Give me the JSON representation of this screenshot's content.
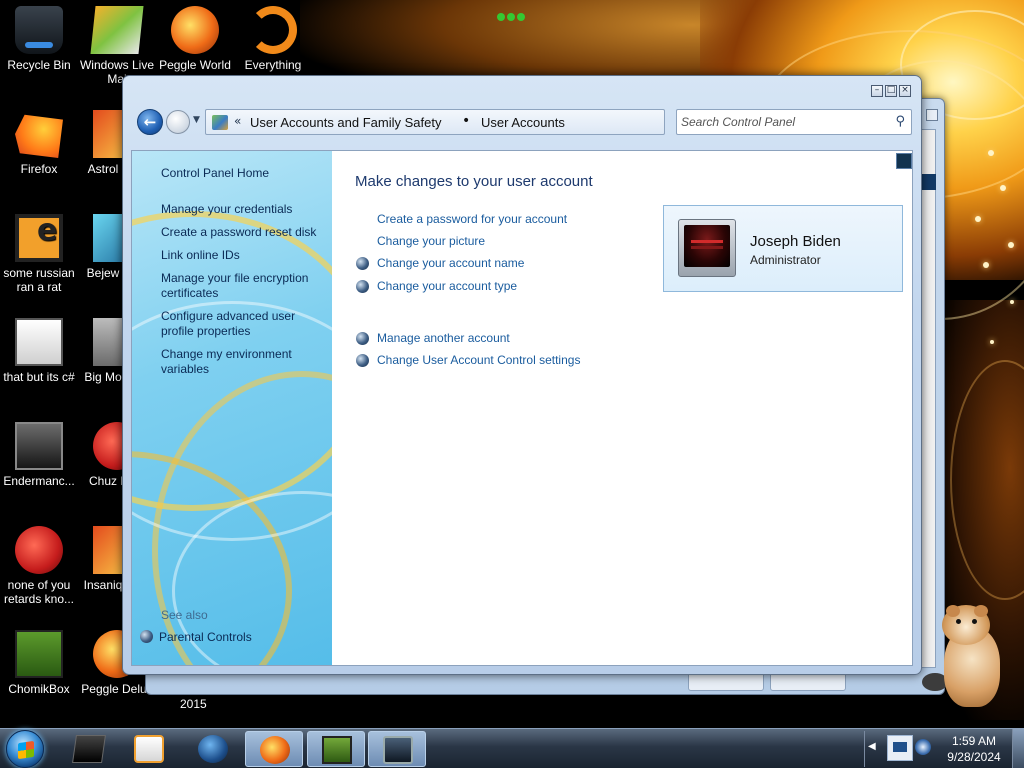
{
  "desktop": {
    "icons": [
      {
        "label": "Recycle Bin",
        "icon": "recycle-bin-icon"
      },
      {
        "label": "Windows Live Mai",
        "icon": "folders-icon"
      },
      {
        "label": "Peggle World",
        "icon": "peggle-icon"
      },
      {
        "label": "Everything",
        "icon": "everything-icon"
      },
      {
        "label": "Firefox",
        "icon": "firefox-icon"
      },
      {
        "label": "Astrol Delu",
        "icon": "game-icon"
      },
      {
        "label": "some russian ran a rat",
        "icon": "orange-e-icon"
      },
      {
        "label": "Bejew Delu",
        "icon": "game-icon"
      },
      {
        "label": "that but its c#",
        "icon": "windows-stack-icon"
      },
      {
        "label": "Big Mo Delu",
        "icon": "game-icon"
      },
      {
        "label": "Endermanc...",
        "icon": "window-icon"
      },
      {
        "label": "Chuz Delu",
        "icon": "game-icon"
      },
      {
        "label": "none of you retards kno...",
        "icon": "red-ball-icon"
      },
      {
        "label": "Insaniq Delu",
        "icon": "game-icon"
      },
      {
        "label": "ChomikBox",
        "icon": "chomikbox-icon"
      },
      {
        "label": "Peggle Delux",
        "icon": "peggle-icon"
      }
    ],
    "stray_label": "2015"
  },
  "window": {
    "breadcrumb": [
      "User Accounts and Family Safety",
      "User Accounts"
    ],
    "breadcrumb_prefix": "«",
    "breadcrumb_separator": "•",
    "search_placeholder": "Search Control Panel",
    "caption_buttons": [
      "minimize",
      "maximize",
      "close"
    ]
  },
  "left_pane": {
    "home": "Control Panel Home",
    "tasks": [
      "Manage your credentials",
      "Create a password reset disk",
      "Link online IDs",
      "Manage your file encryption certificates",
      "Configure advanced user profile properties",
      "Change my environment variables"
    ],
    "see_also_heading": "See also",
    "see_also_items": [
      "Parental Controls"
    ]
  },
  "main": {
    "title": "Make changes to your user account",
    "actions_group1": [
      {
        "label": "Create a password for your account",
        "shield": false
      },
      {
        "label": "Change your picture",
        "shield": false
      },
      {
        "label": "Change your account name",
        "shield": true
      },
      {
        "label": "Change your account type",
        "shield": true
      }
    ],
    "actions_group2": [
      {
        "label": "Manage another account",
        "shield": true
      },
      {
        "label": "Change User Account Control settings",
        "shield": true
      }
    ],
    "account": {
      "name": "Joseph Biden",
      "role": "Administrator"
    }
  },
  "taskbar": {
    "pinned": [
      {
        "icon": "dark-app-icon",
        "active": false
      },
      {
        "icon": "media-player-icon",
        "active": false
      },
      {
        "icon": "globe-browser-icon",
        "active": false
      },
      {
        "icon": "peggle-icon",
        "active": true
      },
      {
        "icon": "chomikbox-icon",
        "active": true
      },
      {
        "icon": "screen-app-icon",
        "active": true
      }
    ],
    "clock_time": "1:59 AM",
    "clock_date": "9/28/2024"
  },
  "colors": {
    "link": "#1a5c9e",
    "title": "#1e3a6e",
    "left_pane_link": "#0a2a55"
  }
}
